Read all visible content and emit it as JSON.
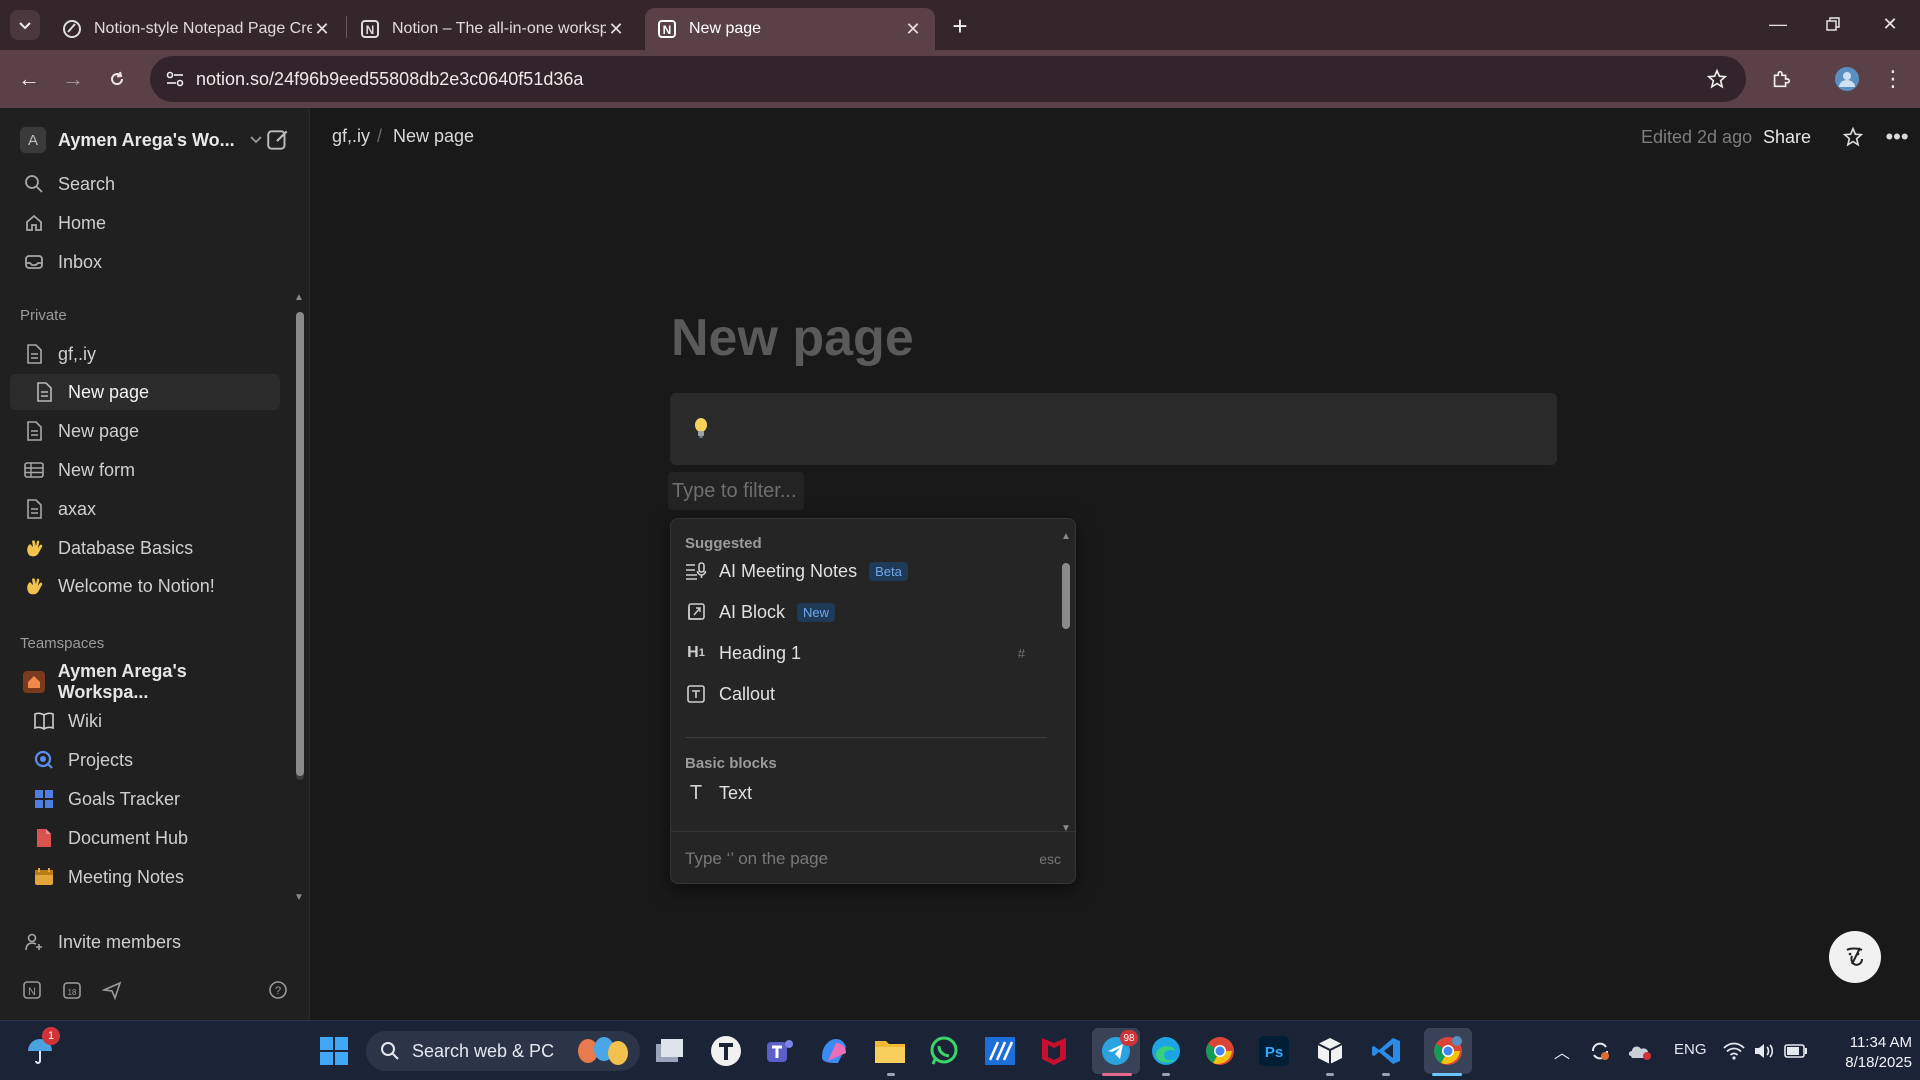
{
  "browser": {
    "tabs": [
      {
        "title": "Notion-style Notepad Page Cre",
        "active": false
      },
      {
        "title": "Notion – The all-in-one worksp",
        "active": false
      },
      {
        "title": "New page",
        "active": true
      }
    ],
    "url": "notion.so/24f96b9eed55808db2e3c0640f51d36a"
  },
  "sidebar": {
    "workspace_initial": "A",
    "workspace_name": "Aymen Arega's Wo...",
    "nav": [
      {
        "label": "Search",
        "icon": "search-icon"
      },
      {
        "label": "Home",
        "icon": "home-icon"
      },
      {
        "label": "Inbox",
        "icon": "inbox-icon"
      }
    ],
    "private_label": "Private",
    "private_pages": [
      {
        "label": "gf,.iy",
        "icon": "page-icon"
      },
      {
        "label": "New page",
        "icon": "page-icon",
        "active": true
      },
      {
        "label": "New page",
        "icon": "page-icon"
      },
      {
        "label": "New form",
        "icon": "table-icon"
      },
      {
        "label": "axax",
        "icon": "page-icon"
      },
      {
        "label": "Database Basics",
        "icon": "wave-emoji-icon"
      },
      {
        "label": "Welcome to Notion!",
        "icon": "wave-emoji-icon"
      }
    ],
    "teamspaces_label": "Teamspaces",
    "teamspace_name": "Aymen Arega's Workspa...",
    "teamspace_pages": [
      {
        "label": "Wiki",
        "icon": "book-icon"
      },
      {
        "label": "Projects",
        "icon": "target-icon"
      },
      {
        "label": "Goals Tracker",
        "icon": "grid-icon"
      },
      {
        "label": "Document Hub",
        "icon": "document-icon"
      },
      {
        "label": "Meeting Notes",
        "icon": "calendar-icon"
      }
    ],
    "invite_label": "Invite members"
  },
  "topbar": {
    "breadcrumb_parent": "gf,.iy",
    "breadcrumb_separator": "/",
    "breadcrumb_current": "New page",
    "edited": "Edited 2d ago",
    "share": "Share"
  },
  "page": {
    "title_placeholder": "New page",
    "callout_icon": "lightbulb-icon",
    "filter_placeholder": "Type to filter..."
  },
  "block_menu": {
    "suggested_label": "Suggested",
    "suggested": [
      {
        "label": "AI Meeting Notes",
        "badge": "Beta",
        "icon": "meeting-notes-icon"
      },
      {
        "label": "AI Block",
        "badge": "New",
        "icon": "ai-block-icon"
      },
      {
        "label": "Heading 1",
        "hint": "#",
        "icon": "heading-icon"
      },
      {
        "label": "Callout",
        "icon": "callout-icon"
      }
    ],
    "basic_label": "Basic blocks",
    "basic": [
      {
        "label": "Text",
        "icon": "text-icon"
      }
    ],
    "footer_text": "Type ‘’ on the page",
    "footer_esc": "esc"
  },
  "taskbar": {
    "search_text": "Search web & PC",
    "lang": "ENG",
    "time": "11:34 AM",
    "date": "8/18/2025",
    "weather_badge": "1",
    "telegram_badge": "98"
  },
  "colors": {
    "tabbar": "#35262b",
    "toolbar": "#5a4148",
    "sidebar": "#202020",
    "main": "#191919",
    "badge_bg": "#1f3a57",
    "badge_text": "#6ea8ea"
  }
}
